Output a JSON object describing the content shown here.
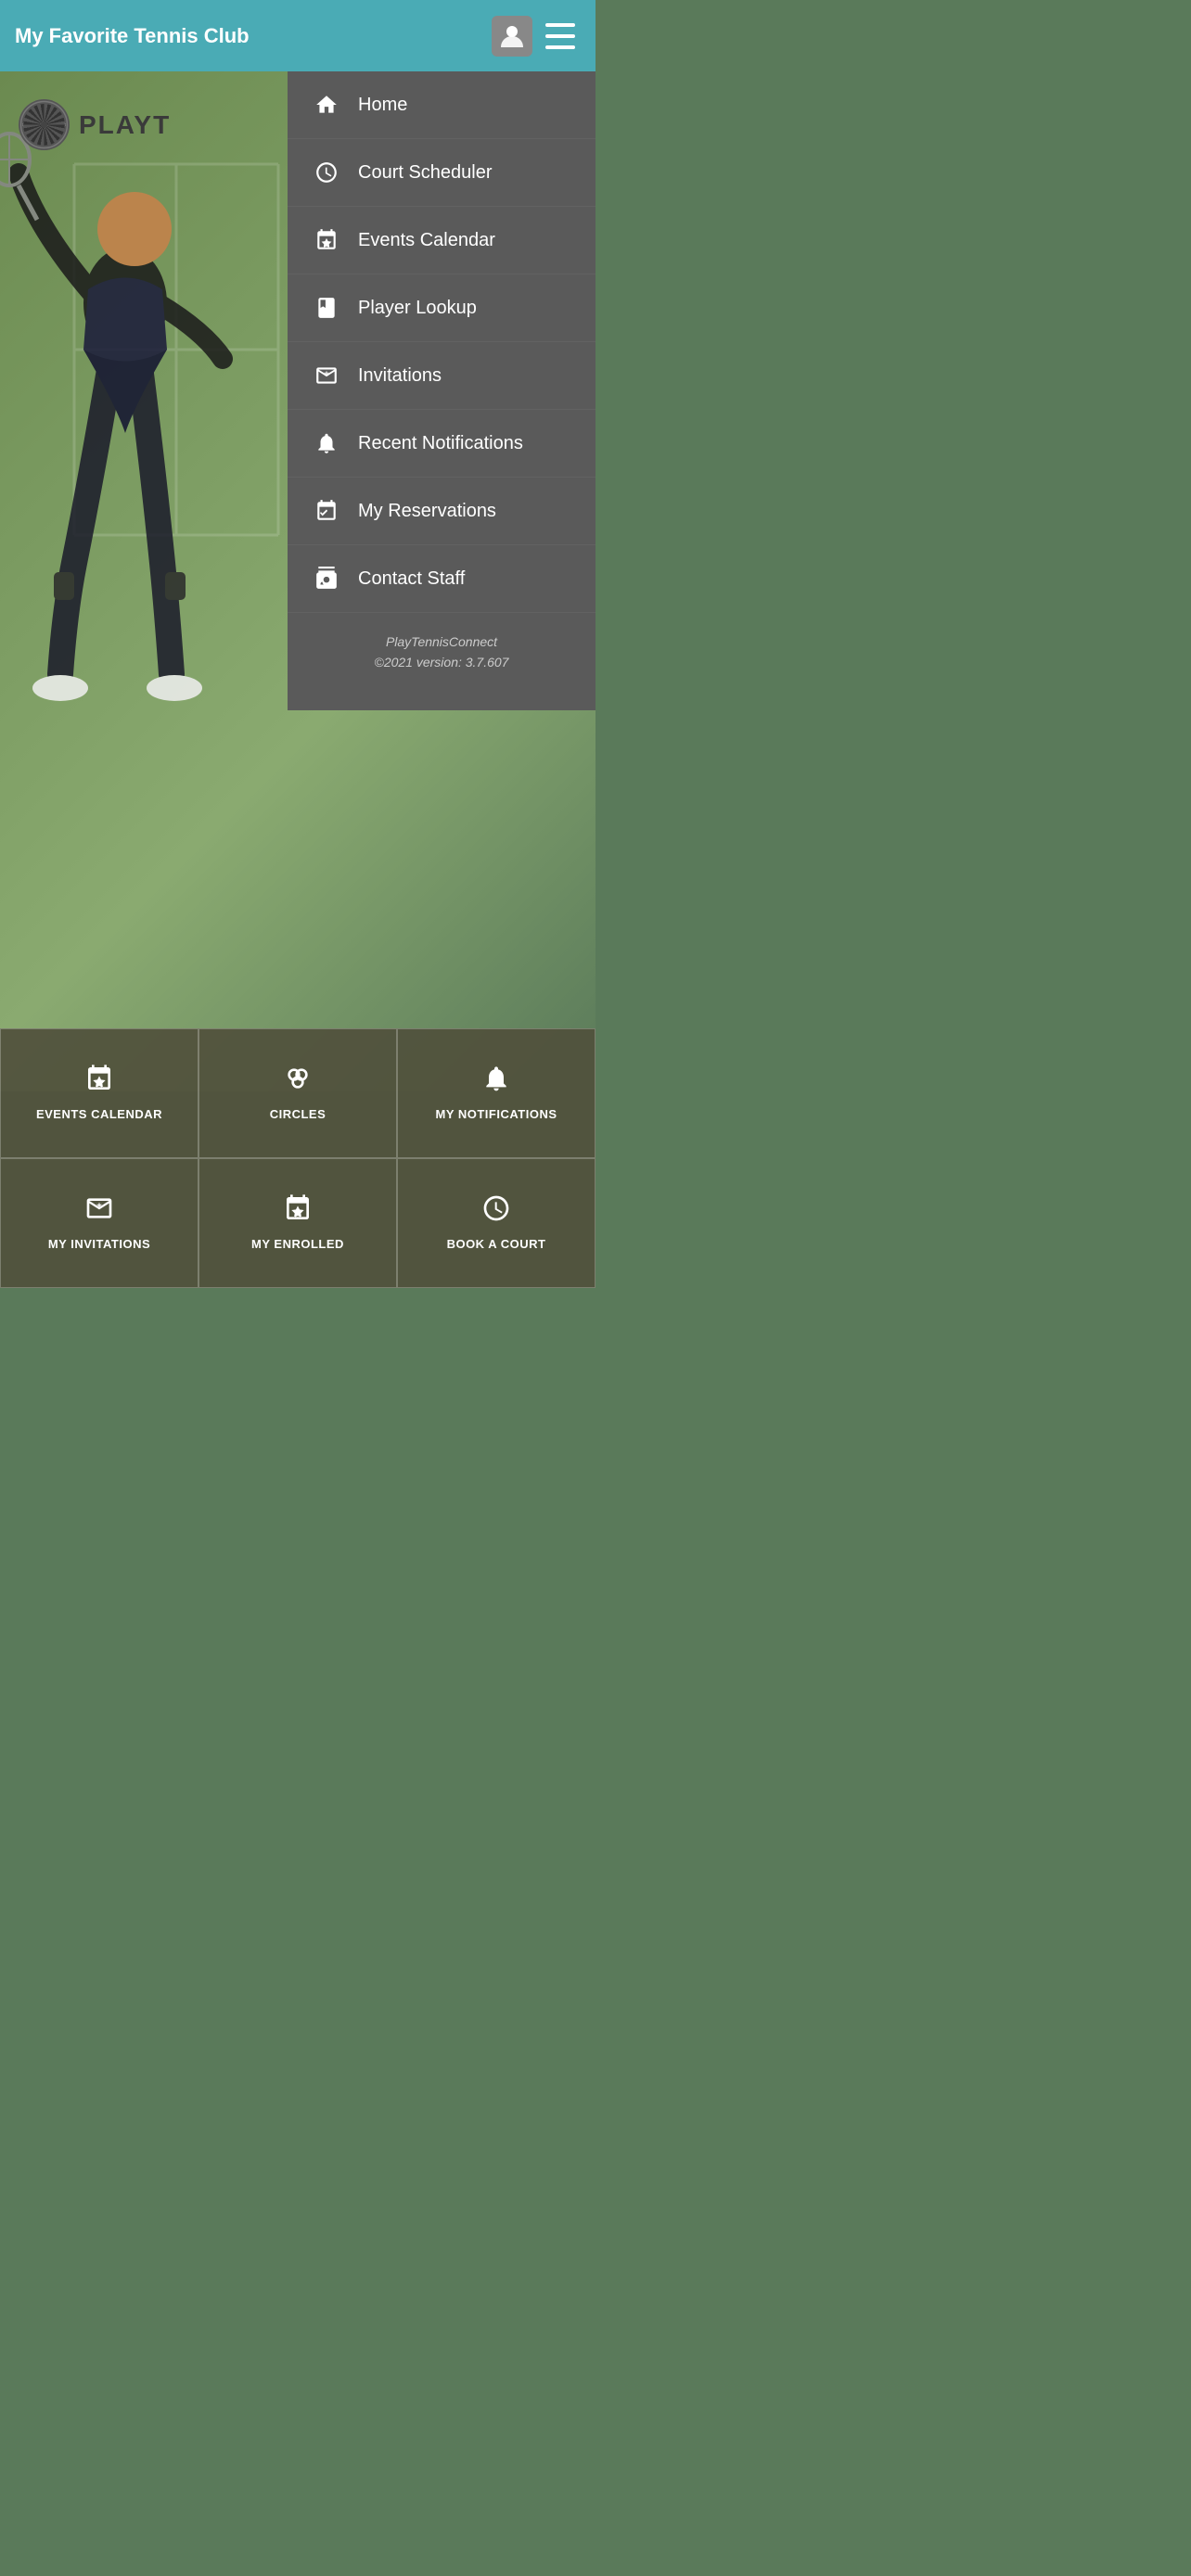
{
  "header": {
    "title": "My Favorite Tennis Club"
  },
  "menu": {
    "items": [
      {
        "id": "home",
        "label": "Home",
        "icon": "home"
      },
      {
        "id": "court-scheduler",
        "label": "Court Scheduler",
        "icon": "clock"
      },
      {
        "id": "events-calendar",
        "label": "Events Calendar",
        "icon": "calendar-star"
      },
      {
        "id": "player-lookup",
        "label": "Player Lookup",
        "icon": "book"
      },
      {
        "id": "invitations",
        "label": "Invitations",
        "icon": "envelope-star"
      },
      {
        "id": "recent-notifications",
        "label": "Recent Notifications",
        "icon": "bell"
      },
      {
        "id": "my-reservations",
        "label": "My Reservations",
        "icon": "calendar-check"
      },
      {
        "id": "contact-staff",
        "label": "Contact Staff",
        "icon": "contact"
      }
    ],
    "footer_line1": "PlayTennisConnect",
    "footer_line2": "©2021 version: 3.7.607"
  },
  "logo": {
    "text": "PLAYT"
  },
  "bottom_tabs": {
    "row1": [
      {
        "id": "events-calendar-tab",
        "icon": "calendar-star",
        "label": "EVENTS\nCALENDAR"
      },
      {
        "id": "circles-tab",
        "icon": "circles",
        "label": "CIRCLES"
      },
      {
        "id": "my-notifications-tab",
        "icon": "bell",
        "label": "MY\nNOTIFICATIONS"
      }
    ],
    "row2": [
      {
        "id": "my-invitations-tab",
        "icon": "envelope-star",
        "label": "MY\nINVITATIONS"
      },
      {
        "id": "my-enrolled-tab",
        "icon": "calendar-star",
        "label": "MY\nENROLLED"
      },
      {
        "id": "book-court-tab",
        "icon": "clock",
        "label": "BOOK A\nCOURT"
      }
    ]
  }
}
